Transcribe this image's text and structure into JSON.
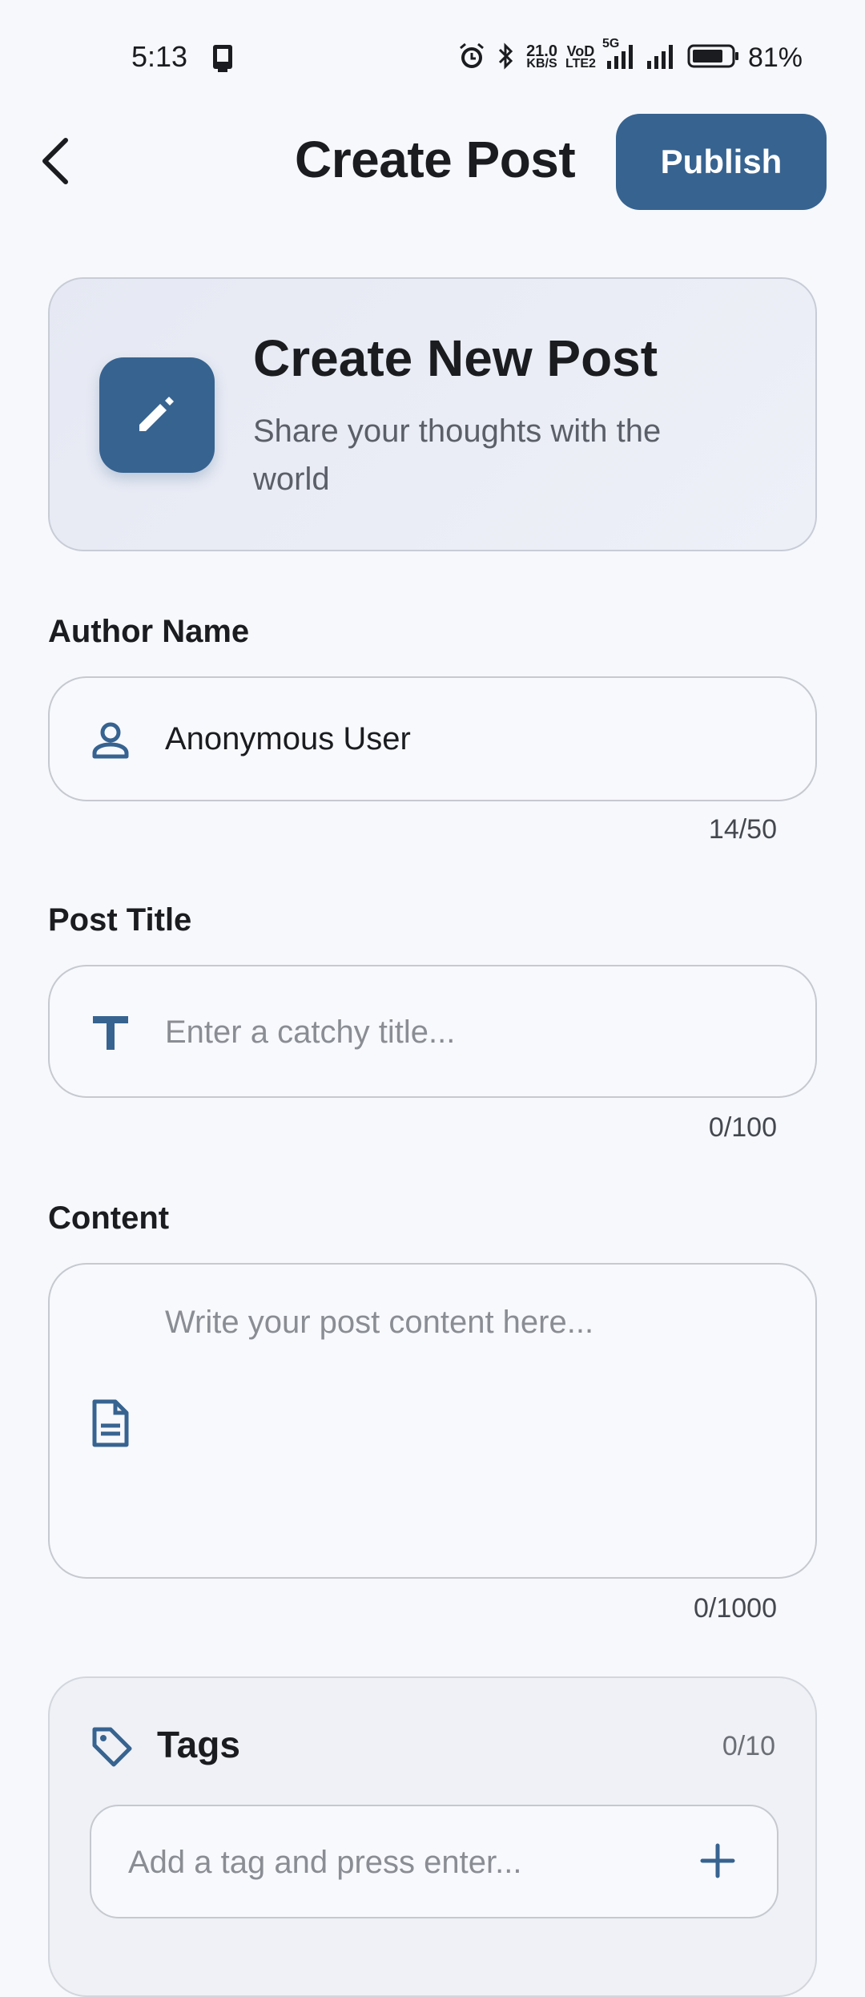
{
  "status_bar": {
    "time": "5:13",
    "net_speed_value": "21.0",
    "net_speed_unit": "KB/S",
    "volte_top": "VoD",
    "volte_bottom": "LTE2",
    "network_type": "5G",
    "battery_percent": "81%",
    "battery_level": 0.81
  },
  "app_bar": {
    "title": "Create Post",
    "publish_label": "Publish"
  },
  "hero": {
    "title": "Create New Post",
    "subtitle": "Share your thoughts with the world"
  },
  "author": {
    "label": "Author Name",
    "value": "Anonymous User",
    "counter": "14/50"
  },
  "title_field": {
    "label": "Post Title",
    "placeholder": "Enter a catchy title...",
    "counter": "0/100"
  },
  "content_field": {
    "label": "Content",
    "placeholder": "Write your post content here...",
    "counter": "0/1000"
  },
  "tags": {
    "title": "Tags",
    "count": "0/10",
    "placeholder": "Add a tag and press enter..."
  },
  "colors": {
    "accent": "#376390",
    "background": "#f6f8fc",
    "text": "#1b1c1f"
  }
}
